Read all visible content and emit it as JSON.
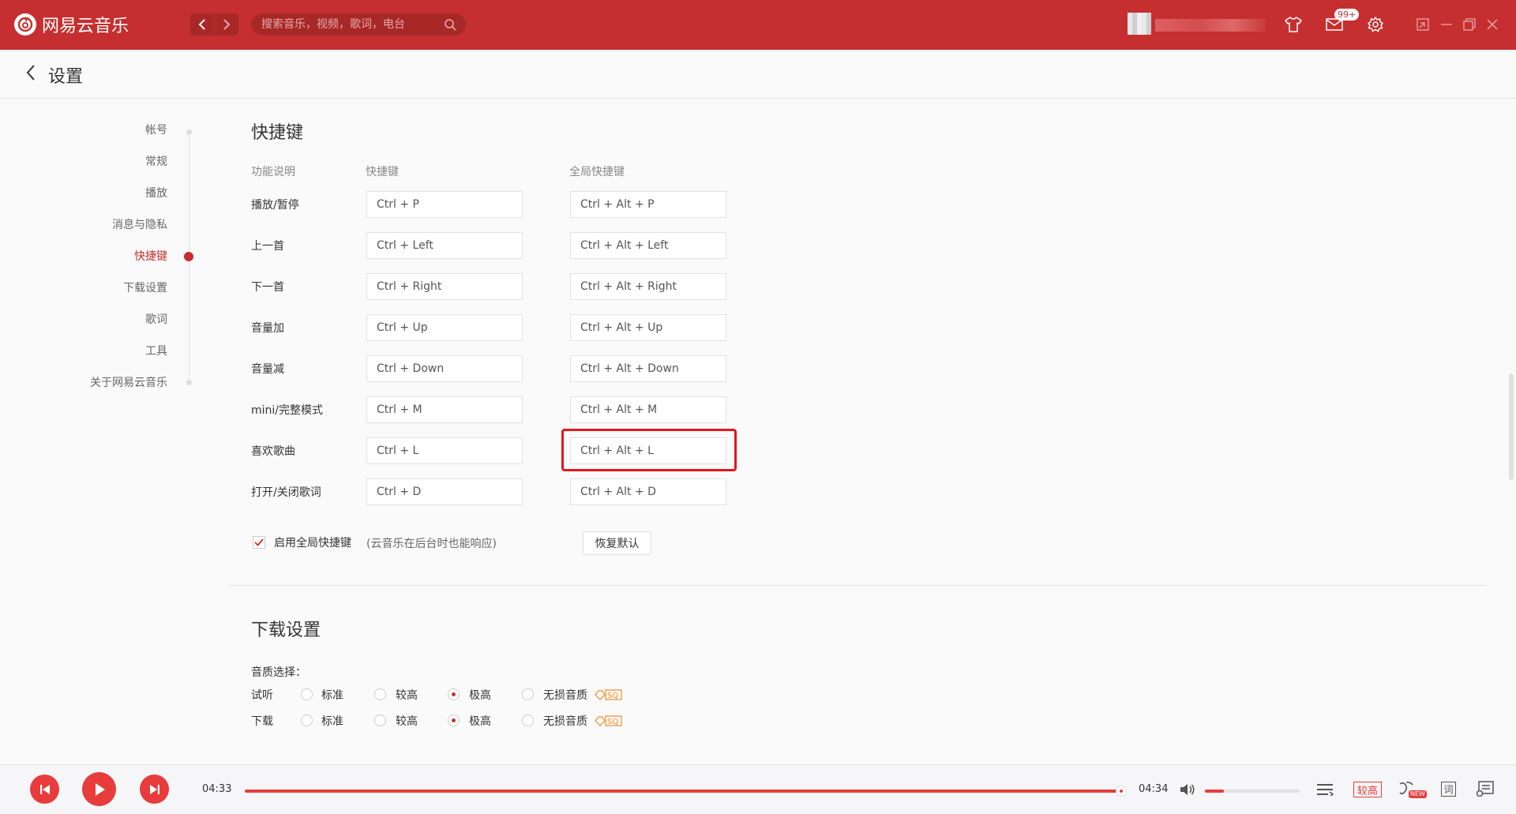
{
  "app": {
    "name": "网易云音乐"
  },
  "search": {
    "placeholder": "搜索音乐，视频，歌词，电台"
  },
  "header": {
    "badge": "99+"
  },
  "page": {
    "title": "设置"
  },
  "sidebar": {
    "items": [
      {
        "label": "帐号",
        "active": false
      },
      {
        "label": "常规",
        "active": false
      },
      {
        "label": "播放",
        "active": false
      },
      {
        "label": "消息与隐私",
        "active": false
      },
      {
        "label": "快捷键",
        "active": true
      },
      {
        "label": "下载设置",
        "active": false
      },
      {
        "label": "歌词",
        "active": false
      },
      {
        "label": "工具",
        "active": false
      },
      {
        "label": "关于网易云音乐",
        "active": false
      }
    ]
  },
  "shortcuts": {
    "title": "快捷键",
    "col_function": "功能说明",
    "col_shortcut": "快捷键",
    "col_global": "全局快捷键",
    "rows": [
      {
        "label": "播放/暂停",
        "key": "Ctrl + P",
        "global": "Ctrl + Alt + P"
      },
      {
        "label": "上一首",
        "key": "Ctrl + Left",
        "global": "Ctrl + Alt + Left"
      },
      {
        "label": "下一首",
        "key": "Ctrl + Right",
        "global": "Ctrl + Alt + Right"
      },
      {
        "label": "音量加",
        "key": "Ctrl + Up",
        "global": "Ctrl + Alt + Up"
      },
      {
        "label": "音量减",
        "key": "Ctrl + Down",
        "global": "Ctrl + Alt + Down"
      },
      {
        "label": "mini/完整模式",
        "key": "Ctrl + M",
        "global": "Ctrl + Alt + M"
      },
      {
        "label": "喜欢歌曲",
        "key": "Ctrl + L",
        "global": "Ctrl + Alt + L"
      },
      {
        "label": "打开/关闭歌词",
        "key": "Ctrl + D",
        "global": "Ctrl + Alt + D"
      }
    ],
    "enable_global_label": "启用全局快捷键",
    "enable_global_hint": "(云音乐在后台时也能响应)",
    "enable_global_checked": true,
    "reset_label": "恢复默认"
  },
  "download": {
    "title": "下载设置",
    "quality_label": "音质选择：",
    "rows": [
      {
        "label": "试听",
        "options": [
          "标准",
          "较高",
          "极高",
          "无损音质"
        ],
        "selected": 2
      },
      {
        "label": "下载",
        "options": [
          "标准",
          "较高",
          "极高",
          "无损音质"
        ],
        "selected": 2
      }
    ],
    "sq_badge": "SQ"
  },
  "player": {
    "current_time": "04:33",
    "total_time": "04:34",
    "progress": 0.996,
    "volume": 0.2,
    "quality": "较高",
    "lyric_btn": "词",
    "new_tag": "NEW"
  },
  "colors": {
    "brand": "#c62f2f",
    "accent": "#e83c3c",
    "highlight": "#e4161c"
  }
}
